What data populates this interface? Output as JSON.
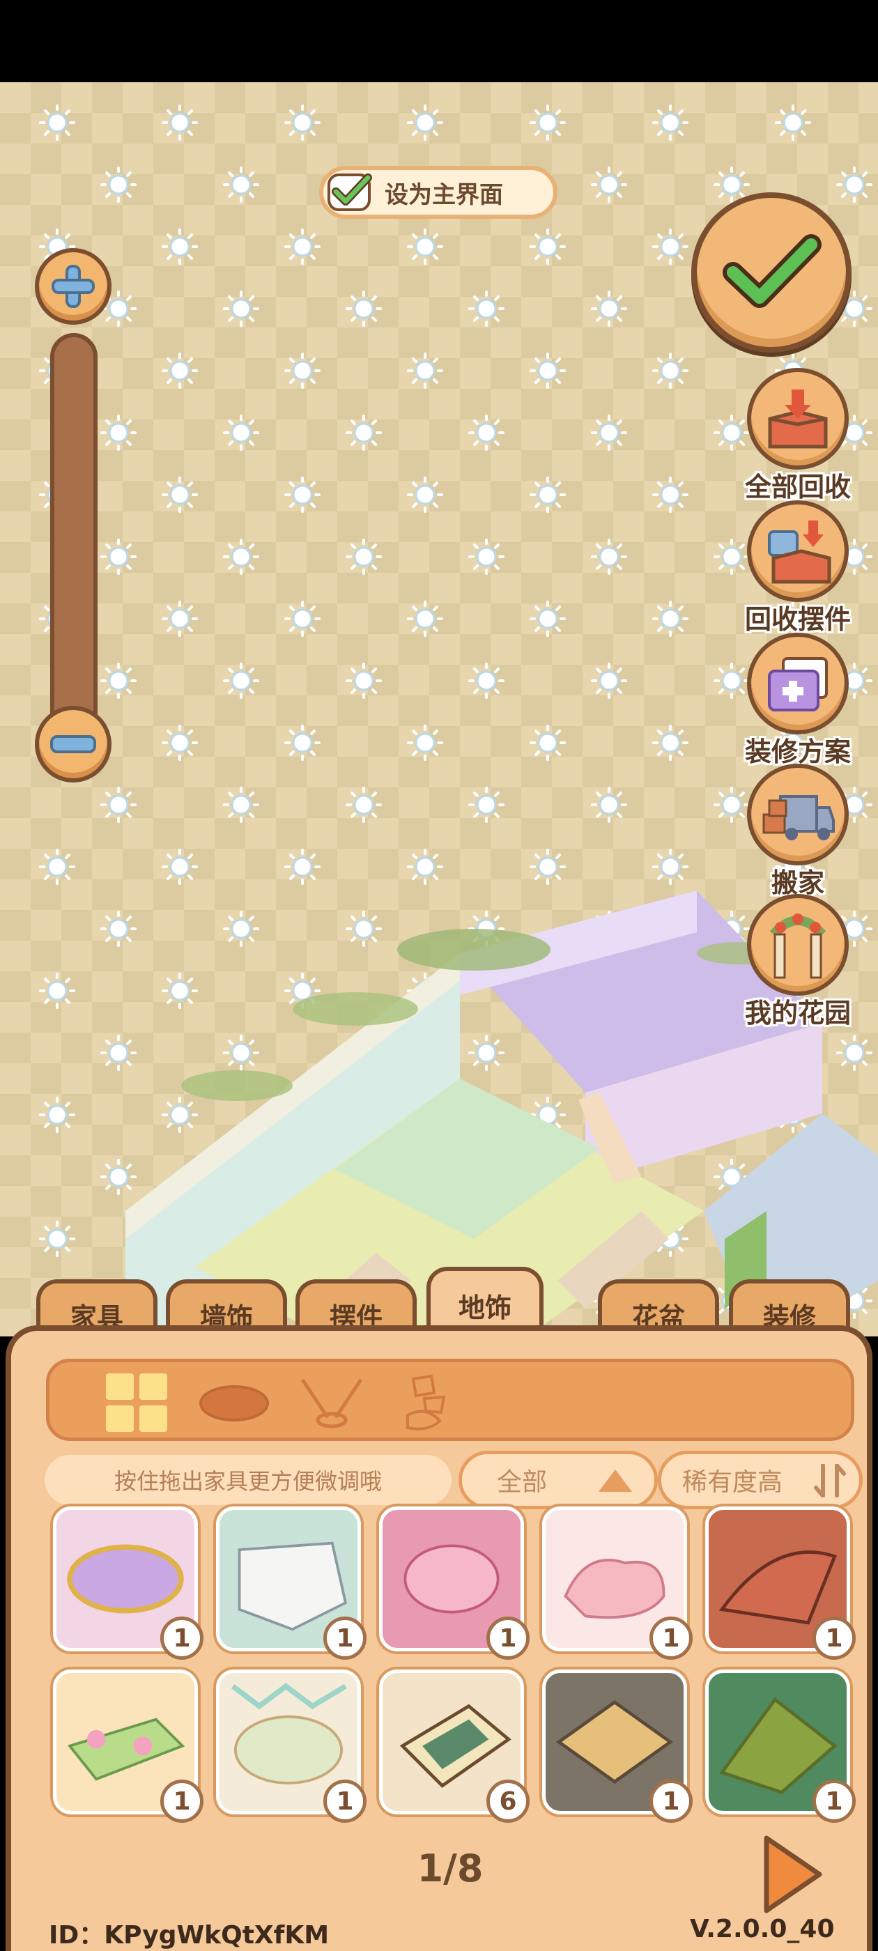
{
  "top": {
    "set_main_label": "设为主界面"
  },
  "side_buttons": [
    {
      "label": "全部回收",
      "icon": "box-recycle-icon"
    },
    {
      "label": "回收摆件",
      "icon": "ornament-recycle-icon"
    },
    {
      "label": "装修方案",
      "icon": "decoration-plan-icon"
    },
    {
      "label": "搬家",
      "icon": "moving-truck-icon"
    },
    {
      "label": "我的花园",
      "icon": "garden-arch-icon"
    }
  ],
  "tabs": [
    {
      "label": "家具"
    },
    {
      "label": "墙饰"
    },
    {
      "label": "摆件"
    },
    {
      "label": "地饰",
      "active": true
    },
    {
      "label": "花盆"
    },
    {
      "label": "装修"
    }
  ],
  "filters": {
    "hint": "按住拖出家具更方便微调哦",
    "category": "全部",
    "sort": "稀有度高"
  },
  "items": [
    {
      "name": "lace-oval-rug",
      "count": "1",
      "bg": "#f3d6e6"
    },
    {
      "name": "fur-rug",
      "count": "1",
      "bg": "#c9e3d8"
    },
    {
      "name": "flower-pile-rug",
      "count": "1",
      "bg": "#e79ab2"
    },
    {
      "name": "pink-cloud-rug",
      "count": "1",
      "bg": "#fbe7e6"
    },
    {
      "name": "rose-semicircle-rug",
      "count": "1",
      "bg": "#c86a4e"
    },
    {
      "name": "blossom-mat",
      "count": "1",
      "bg": "#fbe3bb"
    },
    {
      "name": "party-rug",
      "count": "1",
      "bg": "#f5ebd9"
    },
    {
      "name": "framed-carpet",
      "count": "6",
      "bg": "#f2e3c9"
    },
    {
      "name": "woven-mat",
      "count": "1",
      "bg": "#7d7468"
    },
    {
      "name": "leaf-mat",
      "count": "1",
      "bg": "#4f8b5f"
    }
  ],
  "pager": {
    "text": "1/8"
  },
  "footer": {
    "id": "ID：KPygWkQtXfKM",
    "version": "V.2.0.0_40"
  },
  "colors": {
    "accent": "#f3b878",
    "outline": "#7a4e2e",
    "panel": "#f6c99a",
    "confirm_check": "#5cc055"
  },
  "zoom": {
    "level": 0.08
  }
}
